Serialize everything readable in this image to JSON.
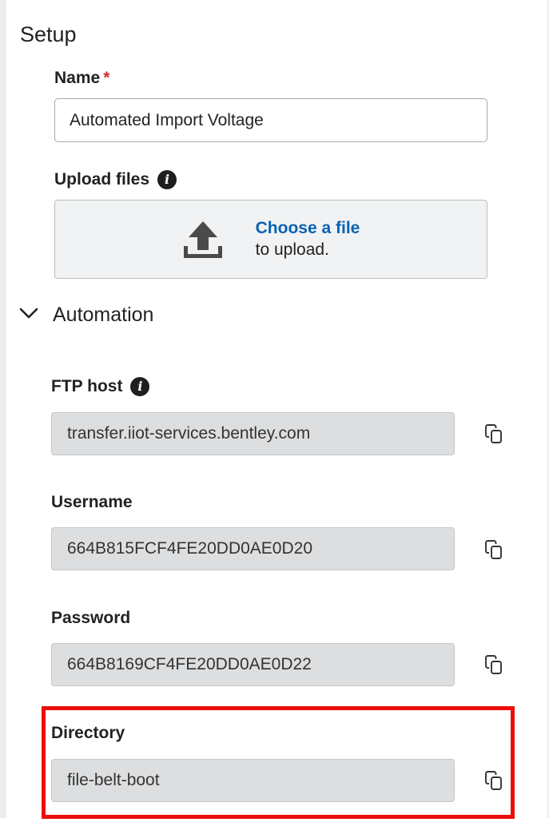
{
  "setup": {
    "title": "Setup",
    "name_label": "Name",
    "required_marker": "*",
    "name_value": "Automated Import Voltage",
    "upload_label": "Upload files",
    "upload_link": "Choose a file",
    "upload_sub": "to upload."
  },
  "automation": {
    "label": "Automation",
    "fields": {
      "ftp_host": {
        "label": "FTP host",
        "value": "transfer.iiot-services.bentley.com"
      },
      "username": {
        "label": "Username",
        "value": "664B815FCF4FE20DD0AE0D20"
      },
      "password": {
        "label": "Password",
        "value": "664B8169CF4FE20DD0AE0D22"
      },
      "directory": {
        "label": "Directory",
        "value": "file-belt-boot"
      }
    }
  },
  "icons": {
    "info": "info-icon",
    "upload": "upload-icon",
    "chevron": "chevron-down-icon",
    "copy": "copy-icon"
  },
  "colors": {
    "required": "#d52a2a",
    "link": "#0a62b3",
    "highlight": "#ee0d0d",
    "readonly_bg": "#dcdee0"
  }
}
